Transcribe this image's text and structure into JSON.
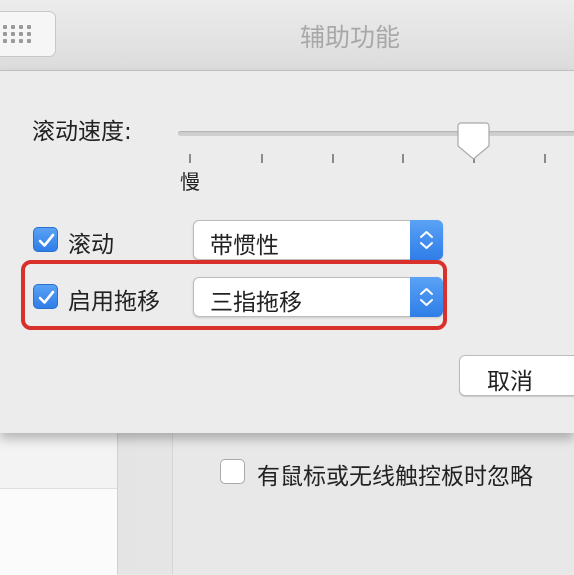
{
  "window": {
    "title": "辅助功能"
  },
  "sheet": {
    "scroll_speed": {
      "label": "滚动速度:",
      "min_label": "慢",
      "level_percent": 72
    },
    "scrolling": {
      "label": "滚动",
      "checked": true,
      "popup_value": "带惯性"
    },
    "drag": {
      "label": "启用拖移",
      "checked": true,
      "popup_value": "三指拖移"
    },
    "cancel_label": "取消"
  },
  "background": {
    "ignore_checkbox": {
      "label": "有鼠标或无线触控板时忽略",
      "checked": false
    }
  },
  "colors": {
    "accent": "#2f7de8",
    "highlight": "#d9302c"
  }
}
